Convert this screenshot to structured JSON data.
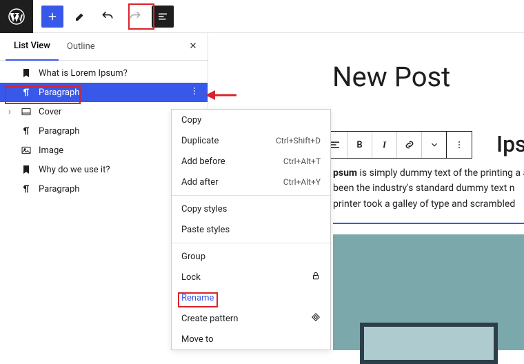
{
  "toolbar": {},
  "panel": {
    "tab_listview": "List View",
    "tab_outline": "Outline"
  },
  "tree": {
    "items": [
      {
        "label": "What is Lorem Ipsum?"
      },
      {
        "label": "Paragraph"
      },
      {
        "label": "Cover"
      },
      {
        "label": "Paragraph"
      },
      {
        "label": "Image"
      },
      {
        "label": "Why do we use it?"
      },
      {
        "label": "Paragraph"
      }
    ]
  },
  "content": {
    "title": "New Post",
    "heading_fragment": "Ips",
    "paragraph_bold": "psum",
    "paragraph_rest": " is simply dummy text of the printing a as been the industry's standard dummy text n printer took a galley of type and scrambled"
  },
  "block_toolbar": {
    "bold": "B",
    "italic": "I"
  },
  "context_menu": {
    "copy": "Copy",
    "duplicate": "Duplicate",
    "duplicate_sc": "Ctrl+Shift+D",
    "add_before": "Add before",
    "add_before_sc": "Ctrl+Alt+T",
    "add_after": "Add after",
    "add_after_sc": "Ctrl+Alt+Y",
    "copy_styles": "Copy styles",
    "paste_styles": "Paste styles",
    "group": "Group",
    "lock": "Lock",
    "rename": "Rename",
    "create_pattern": "Create pattern",
    "move_to": "Move to"
  }
}
